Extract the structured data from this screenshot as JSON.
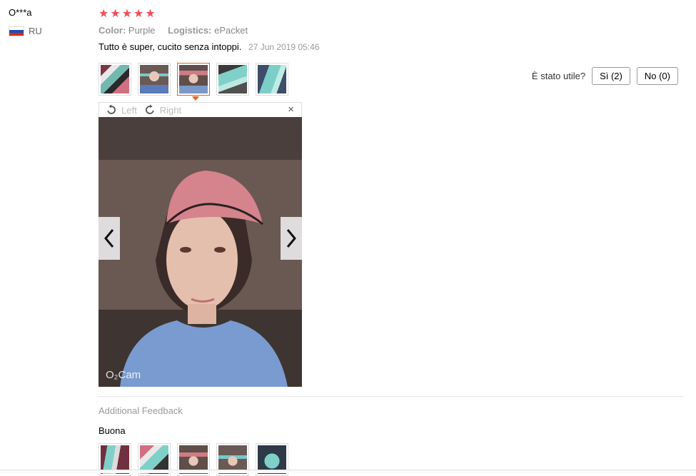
{
  "user": {
    "name": "O***a",
    "country": "RU"
  },
  "rating": {
    "stars": "★★★★★"
  },
  "attributes": {
    "color_label": "Color:",
    "color_value": "Purple",
    "logistics_label": "Logistics:",
    "logistics_value": "ePacket"
  },
  "review": {
    "text": "Tutto è super, cucito senza intoppi.",
    "date": "27 Jun 2019 05:46"
  },
  "helpful": {
    "question": "È stato utile?",
    "yes_label": "Sì (2)",
    "no_label": "No (0)"
  },
  "viewer": {
    "rotate_left": "Left",
    "rotate_right": "Right",
    "close": "×",
    "watermark": "O₂Cam"
  },
  "additional": {
    "title": "Additional Feedback",
    "text": "Buona"
  },
  "colors": {
    "star": "#f04e5a",
    "active_border": "#e3621a"
  }
}
